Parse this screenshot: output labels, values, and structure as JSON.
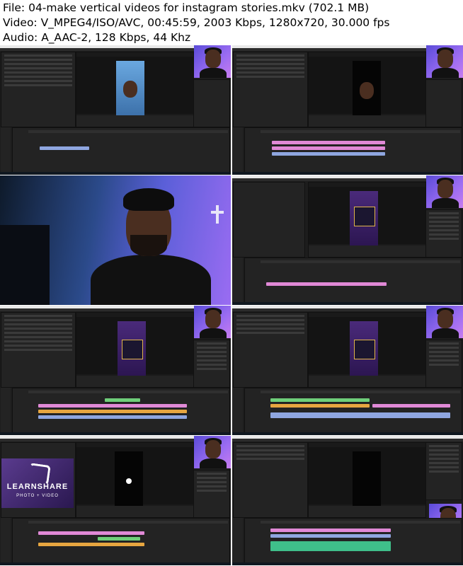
{
  "header": {
    "file_line": "File: 04-make vertical videos for instagram stories.mkv (702.1 MB)",
    "video_line": "Video: V_MPEG4/ISO/AVC, 00:45:59, 2003 Kbps, 1280x720, 30.000 fps",
    "audio_line": "Audio: A_AAC-2, 128 Kbps, 44 Khz"
  },
  "logo": {
    "line1": "LEARNSHARE",
    "line2": "PHOTO + VIDEO"
  },
  "colors": {
    "editor_bg": "#1d1d1d",
    "clip_pink": "#e089d6",
    "clip_blue": "#8fa6e0",
    "clip_green": "#6fcf7a",
    "clip_orange": "#e7a640",
    "audio_green": "#3fbf8a",
    "accent_purple": "#9a6cf2"
  }
}
